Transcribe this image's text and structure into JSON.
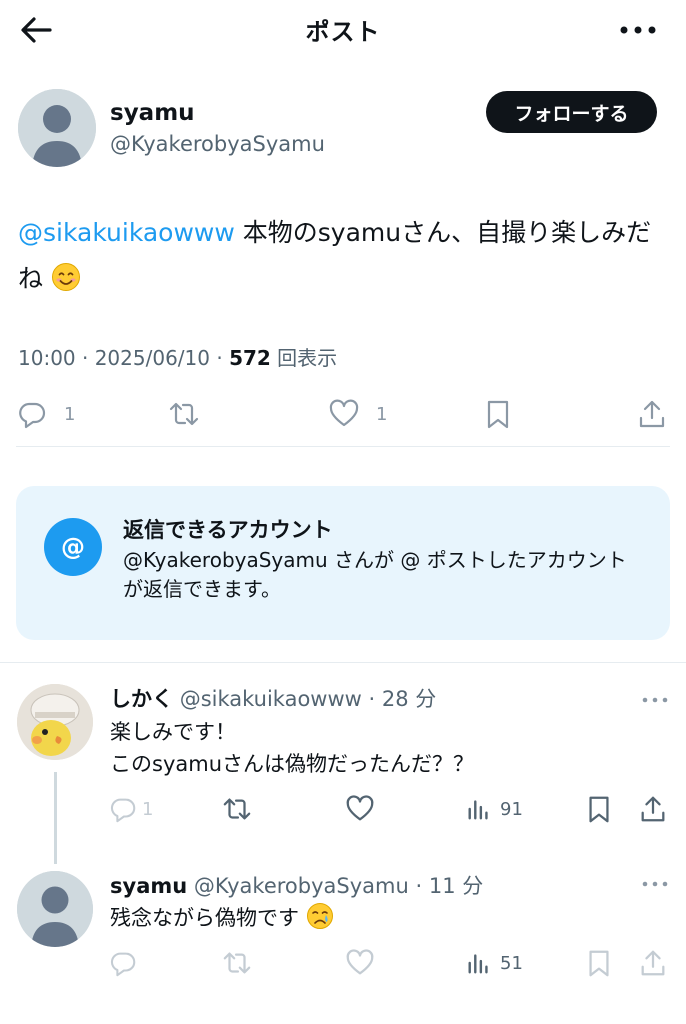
{
  "header": {
    "title": "ポスト"
  },
  "author": {
    "name": "syamu",
    "handle": "@KyakerobyaSyamu",
    "follow_label": "フォローする"
  },
  "post": {
    "mention": "@sikakuikaowww",
    "text": " 本物のsyamuさん、自撮り楽しみだね",
    "time": "10:00 · 2025/06/10 · ",
    "views": "572",
    "views_label": " 回表示"
  },
  "actions": {
    "reply_count": "1",
    "like_count": "1"
  },
  "notice": {
    "title": "返信できるアカウント",
    "body": "@KyakerobyaSyamu さんが @ ポストしたアカウントが返信できます。",
    "icon": "@"
  },
  "replies": [
    {
      "name": "しかく",
      "handle": "@sikakuikaowww",
      "time": " · 28 分",
      "lines": [
        "楽しみです！",
        "このsyamuさんは偽物だったんだ？？"
      ],
      "reply_count": "1",
      "views": "91"
    },
    {
      "name": "syamu",
      "handle": "@KyakerobyaSyamu",
      "time": " · 11 分",
      "lines": [
        "残念ながら偽物です"
      ],
      "views": "51"
    }
  ],
  "icons": [
    "back-arrow-icon",
    "more-icon",
    "reply-icon",
    "repost-icon",
    "like-icon",
    "bookmark-icon",
    "share-icon",
    "views-icon",
    "smile-emoji",
    "cry-emoji"
  ]
}
